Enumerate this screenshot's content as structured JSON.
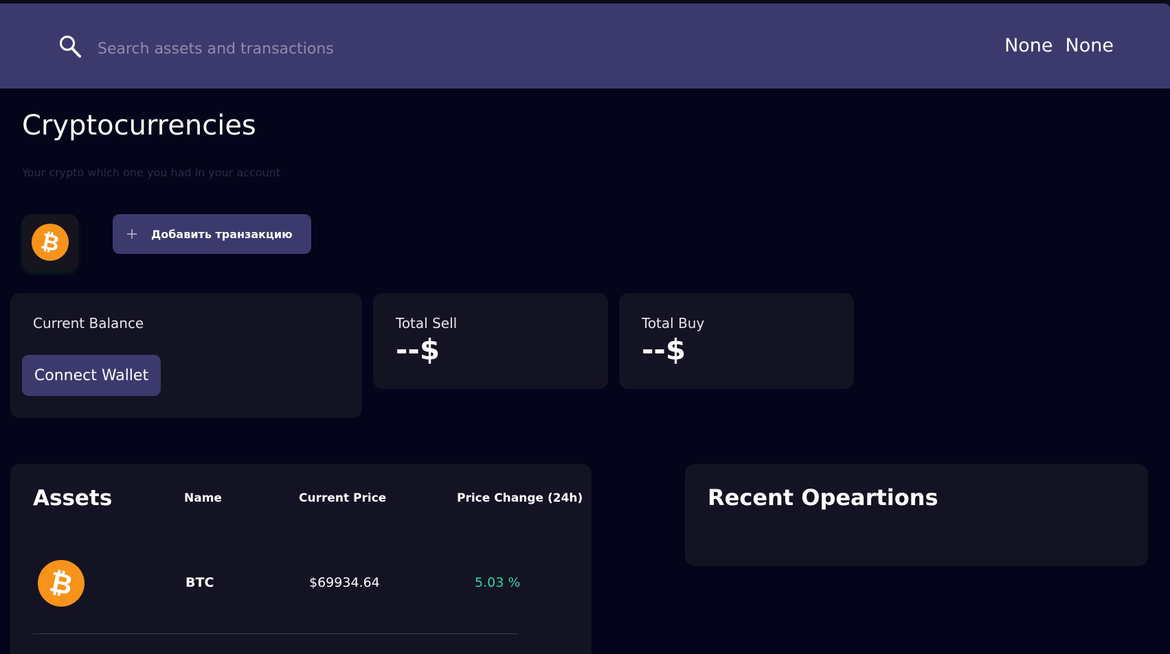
{
  "header": {
    "search_placeholder": "Search assets and transactions",
    "user_first": "None",
    "user_last": "None"
  },
  "page": {
    "title": "Cryptocurrencies",
    "subtitle": "Your crypto which one you had in your account"
  },
  "actions": {
    "add_transaction_label": "Добавить транзакцию"
  },
  "balance": {
    "label": "Current Balance",
    "connect_wallet_label": "Connect Wallet"
  },
  "total_sell": {
    "label": "Total Sell",
    "value": "--$"
  },
  "total_buy": {
    "label": "Total Buy",
    "value": "--$"
  },
  "assets": {
    "title": "Assets",
    "columns": {
      "name": "Name",
      "price": "Current Price",
      "change": "Price Change (24h)"
    },
    "rows": [
      {
        "icon": "bitcoin-icon",
        "name": "BTC",
        "price": "$69934.64",
        "change": "5.03 %"
      }
    ]
  },
  "recent": {
    "title": "Recent Opeartions"
  },
  "colors": {
    "background": "#04041a",
    "header": "#3c3a6d",
    "card": "#141323",
    "accent": "#3c3a6d",
    "positive": "#2ed6a0",
    "bitcoin": "#f7931a"
  }
}
